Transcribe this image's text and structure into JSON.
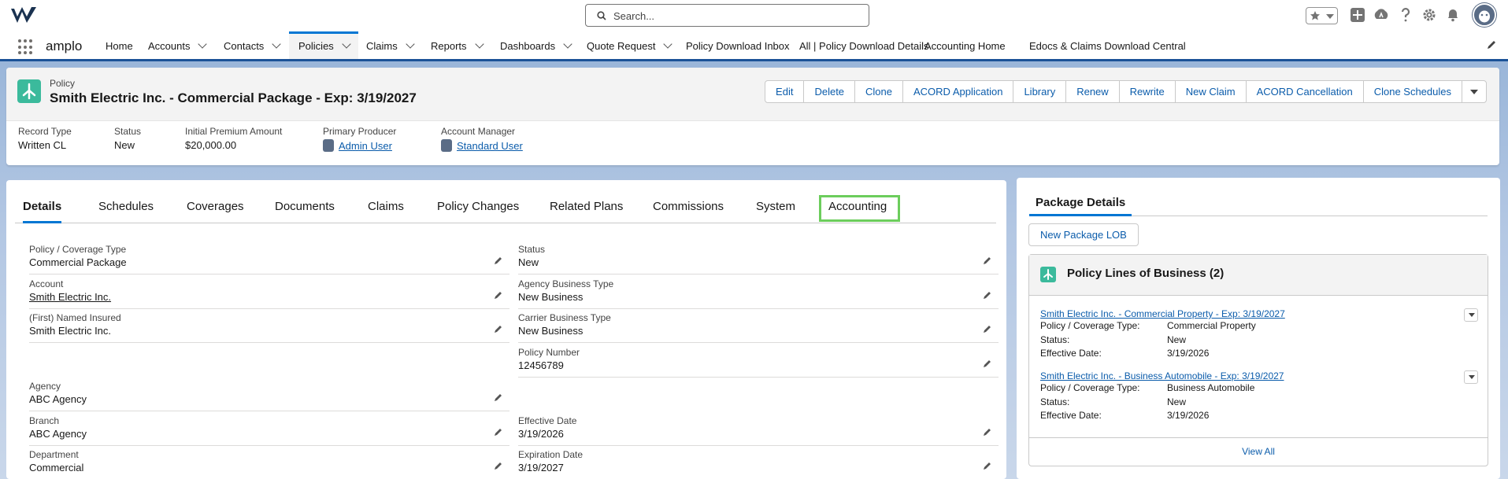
{
  "header": {
    "search_placeholder": "Search...",
    "icons": [
      "favorites-star-icon",
      "favorites-dropdown-icon",
      "global-add-icon",
      "trailhead-icon",
      "help-icon",
      "setup-gear-icon",
      "notifications-bell-icon",
      "user-avatar"
    ]
  },
  "nav": {
    "app_name": "amplo",
    "items": [
      {
        "label": "Home",
        "chevron": false
      },
      {
        "label": "Accounts",
        "chevron": true
      },
      {
        "label": "Contacts",
        "chevron": true
      },
      {
        "label": "Policies",
        "chevron": true,
        "active": true
      },
      {
        "label": "Claims",
        "chevron": true
      },
      {
        "label": "Reports",
        "chevron": true
      },
      {
        "label": "Dashboards",
        "chevron": true
      },
      {
        "label": "Quote Request",
        "chevron": true
      },
      {
        "label": "Policy Download Inbox",
        "chevron": false
      },
      {
        "label": "All | Policy Download Details",
        "chevron": false
      },
      {
        "label": "Accounting Home",
        "chevron": false
      },
      {
        "label": "Edocs & Claims Download Central",
        "chevron": false
      }
    ]
  },
  "record": {
    "object_type": "Policy",
    "name": "Smith Electric Inc. - Commercial Package - Exp: 3/19/2027",
    "actions": [
      "Edit",
      "Delete",
      "Clone",
      "ACORD Application",
      "Library",
      "Renew",
      "Rewrite",
      "New Claim",
      "ACORD Cancellation",
      "Clone Schedules"
    ],
    "highlights": [
      {
        "label": "Record Type",
        "value": "Written CL"
      },
      {
        "label": "Status",
        "value": "New"
      },
      {
        "label": "Initial Premium Amount",
        "value": "$20,000.00"
      },
      {
        "label": "Primary Producer",
        "value": "Admin User"
      },
      {
        "label": "Account Manager",
        "value": "Standard User"
      }
    ]
  },
  "tabs": [
    "Details",
    "Schedules",
    "Coverages",
    "Documents",
    "Claims",
    "Policy Changes",
    "Related Plans",
    "Commissions",
    "System",
    "Accounting"
  ],
  "details": {
    "left": [
      {
        "label": "Policy / Coverage Type",
        "value": "Commercial Package"
      },
      {
        "label": "Account",
        "value": "Smith Electric Inc."
      },
      {
        "label": "(First) Named Insured",
        "value": "Smith Electric Inc."
      },
      {
        "label": "Agency",
        "value": "ABC Agency"
      },
      {
        "label": "Branch",
        "value": "ABC Agency"
      },
      {
        "label": "Department",
        "value": "Commercial"
      }
    ],
    "right": [
      {
        "label": "Status",
        "value": "New"
      },
      {
        "label": "Agency Business Type",
        "value": "New Business"
      },
      {
        "label": "Carrier Business Type",
        "value": "New Business"
      },
      {
        "label": "Policy Number",
        "value": "12456789"
      },
      {
        "label": "Effective Date",
        "value": "3/19/2026"
      },
      {
        "label": "Expiration Date",
        "value": "3/19/2027"
      }
    ]
  },
  "package": {
    "tab": "Package Details",
    "new_button": "New Package LOB",
    "list_title": "Policy Lines of Business (2)",
    "items": [
      {
        "name": "Smith Electric Inc. - Commercial Property - Exp: 3/19/2027",
        "type_label": "Policy / Coverage Type:",
        "type": "Commercial Property",
        "status_label": "Status:",
        "status": "New",
        "eff_label": "Effective Date:",
        "eff": "3/19/2026"
      },
      {
        "name": "Smith Electric Inc. - Business Automobile - Exp: 3/19/2027",
        "type_label": "Policy / Coverage Type:",
        "type": "Business Automobile",
        "status_label": "Status:",
        "status": "New",
        "eff_label": "Effective Date:",
        "eff": "3/19/2026"
      }
    ],
    "view_all": "View All"
  }
}
